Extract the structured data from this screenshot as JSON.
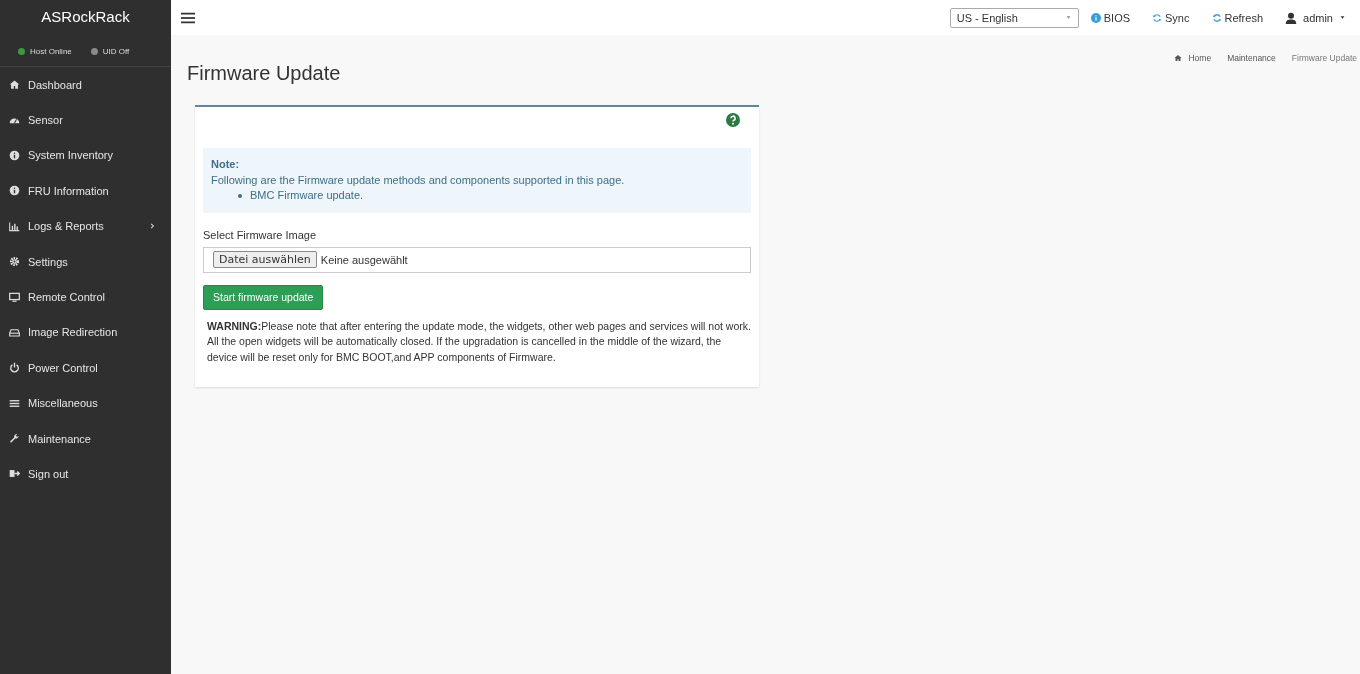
{
  "sidebar": {
    "brand": "ASRockRack",
    "status": [
      {
        "label": "Host Online",
        "color": "#3c9a3c"
      },
      {
        "label": "UID Off",
        "color": "#8a8a8a"
      }
    ],
    "items": [
      {
        "label": "Dashboard",
        "submenu": false
      },
      {
        "label": "Sensor",
        "submenu": false
      },
      {
        "label": "System Inventory",
        "submenu": false
      },
      {
        "label": "FRU Information",
        "submenu": false
      },
      {
        "label": "Logs & Reports",
        "submenu": true
      },
      {
        "label": "Settings",
        "submenu": false
      },
      {
        "label": "Remote Control",
        "submenu": false
      },
      {
        "label": "Image Redirection",
        "submenu": false
      },
      {
        "label": "Power Control",
        "submenu": false
      },
      {
        "label": "Miscellaneous",
        "submenu": false
      },
      {
        "label": "Maintenance",
        "submenu": false
      },
      {
        "label": "Sign out",
        "submenu": false
      }
    ]
  },
  "topbar": {
    "language": "US - English",
    "links": [
      "BIOS",
      "Sync",
      "Refresh"
    ],
    "user": "admin"
  },
  "page": {
    "title": "Firmware Update",
    "breadcrumb": [
      "Home",
      "Maintenance",
      "Firmware Update"
    ]
  },
  "card": {
    "note_title": "Note:",
    "note_text": "Following are the Firmware update methods and components supported in this page.",
    "note_items": [
      "BMC Firmware update."
    ],
    "field_label": "Select Firmware Image",
    "file_button": "Datei auswählen",
    "file_status": "Keine ausgewählt",
    "submit": "Start firmware update",
    "warning": "**WARNING:**Please note that after entering the update mode, the widgets, other web pages and services will not work. All the open widgets will be automatically closed. If the upgradation is cancelled in the middle of the wizard, the device will be reset only for BMC BOOT,and APP components of Firmware."
  }
}
